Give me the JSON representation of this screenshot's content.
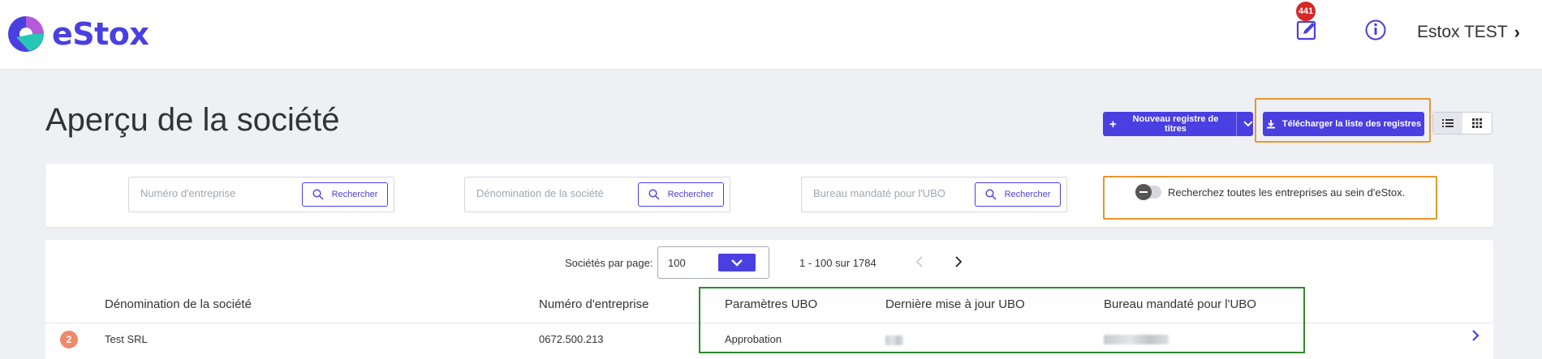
{
  "header": {
    "logo_text": "eStox",
    "notification_count": "441",
    "user_name": "Estox TEST"
  },
  "page": {
    "title": "Aperçu de la société",
    "new_register_label": "Nouveau registre de titres",
    "download_label": "Télécharger la liste des registres"
  },
  "search": {
    "company_number": {
      "placeholder": "Numéro d'entreprise",
      "button": "Rechercher"
    },
    "company_name": {
      "placeholder": "Dénomination de la société",
      "button": "Rechercher"
    },
    "ubo_office": {
      "placeholder": "Bureau mandaté pour l'UBO",
      "button": "Rechercher"
    },
    "toggle_label": "Recherchez toutes les entreprises au sein d'eStox."
  },
  "pagination": {
    "per_page_label": "Sociétés par page:",
    "per_page_value": "100",
    "range_text": "1 - 100 sur 1784"
  },
  "table": {
    "columns": [
      "Dénomination de la société",
      "Numéro d'entreprise",
      "Paramètres UBO",
      "Dernière mise à jour UBO",
      "Bureau mandaté pour l'UBO"
    ],
    "rows": [
      {
        "rank": "2",
        "name": "Test SRL",
        "number": "0672.500.213",
        "ubo_params": "Approbation"
      }
    ]
  },
  "colors": {
    "accent": "#4a3fe0",
    "highlight_orange": "#e8962f",
    "highlight_green": "#2e8b2e",
    "badge_red": "#d62828",
    "rank_badge": "#ef8a6d"
  }
}
